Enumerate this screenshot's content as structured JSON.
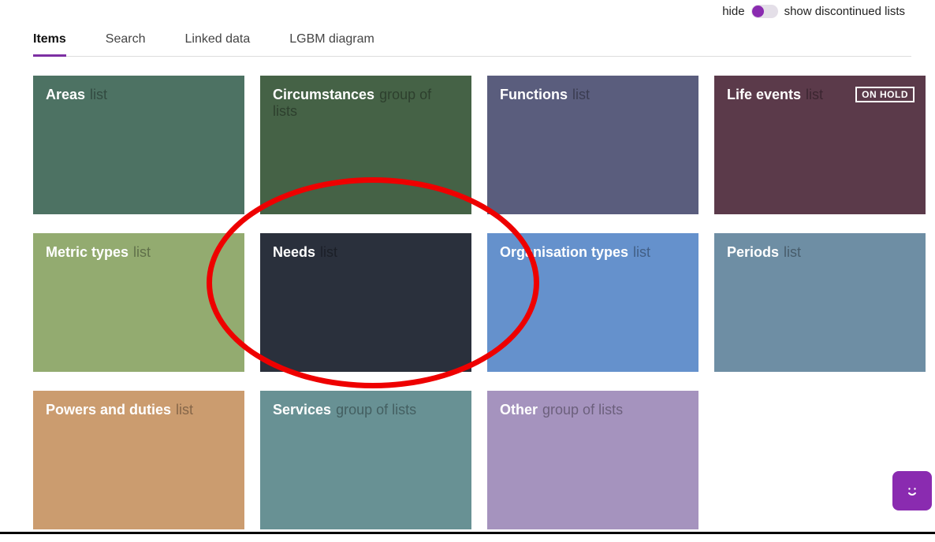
{
  "toggle": {
    "hide": "hide",
    "show": "show discontinued lists"
  },
  "tabs": [
    {
      "label": "Items",
      "active": true
    },
    {
      "label": "Search",
      "active": false
    },
    {
      "label": "Linked data",
      "active": false
    },
    {
      "label": "LGBM diagram",
      "active": false
    }
  ],
  "cards": [
    {
      "title": "Areas",
      "type": "list",
      "color": "#4d7263",
      "badge": null
    },
    {
      "title": "Circumstances",
      "type": "group of lists",
      "color": "#456246",
      "badge": null
    },
    {
      "title": "Functions",
      "type": "list",
      "color": "#5a5d7d",
      "badge": null
    },
    {
      "title": "Life events",
      "type": "list",
      "color": "#5b3a4a",
      "badge": "ON HOLD"
    },
    {
      "title": "Metric types",
      "type": "list",
      "color": "#93ab70",
      "badge": null
    },
    {
      "title": "Needs",
      "type": "list",
      "color": "#2a303c",
      "badge": null
    },
    {
      "title": "Organisation types",
      "type": "list",
      "color": "#6591cc",
      "badge": null
    },
    {
      "title": "Periods",
      "type": "list",
      "color": "#6e8ea4",
      "badge": null
    },
    {
      "title": "Powers and duties",
      "type": "list",
      "color": "#cb9c6f",
      "badge": null
    },
    {
      "title": "Services",
      "type": "group of lists",
      "color": "#689194",
      "badge": null
    },
    {
      "title": "Other",
      "type": "group of lists",
      "color": "#a593be",
      "badge": null
    }
  ],
  "annotation": {
    "circle_target_index": 5
  }
}
